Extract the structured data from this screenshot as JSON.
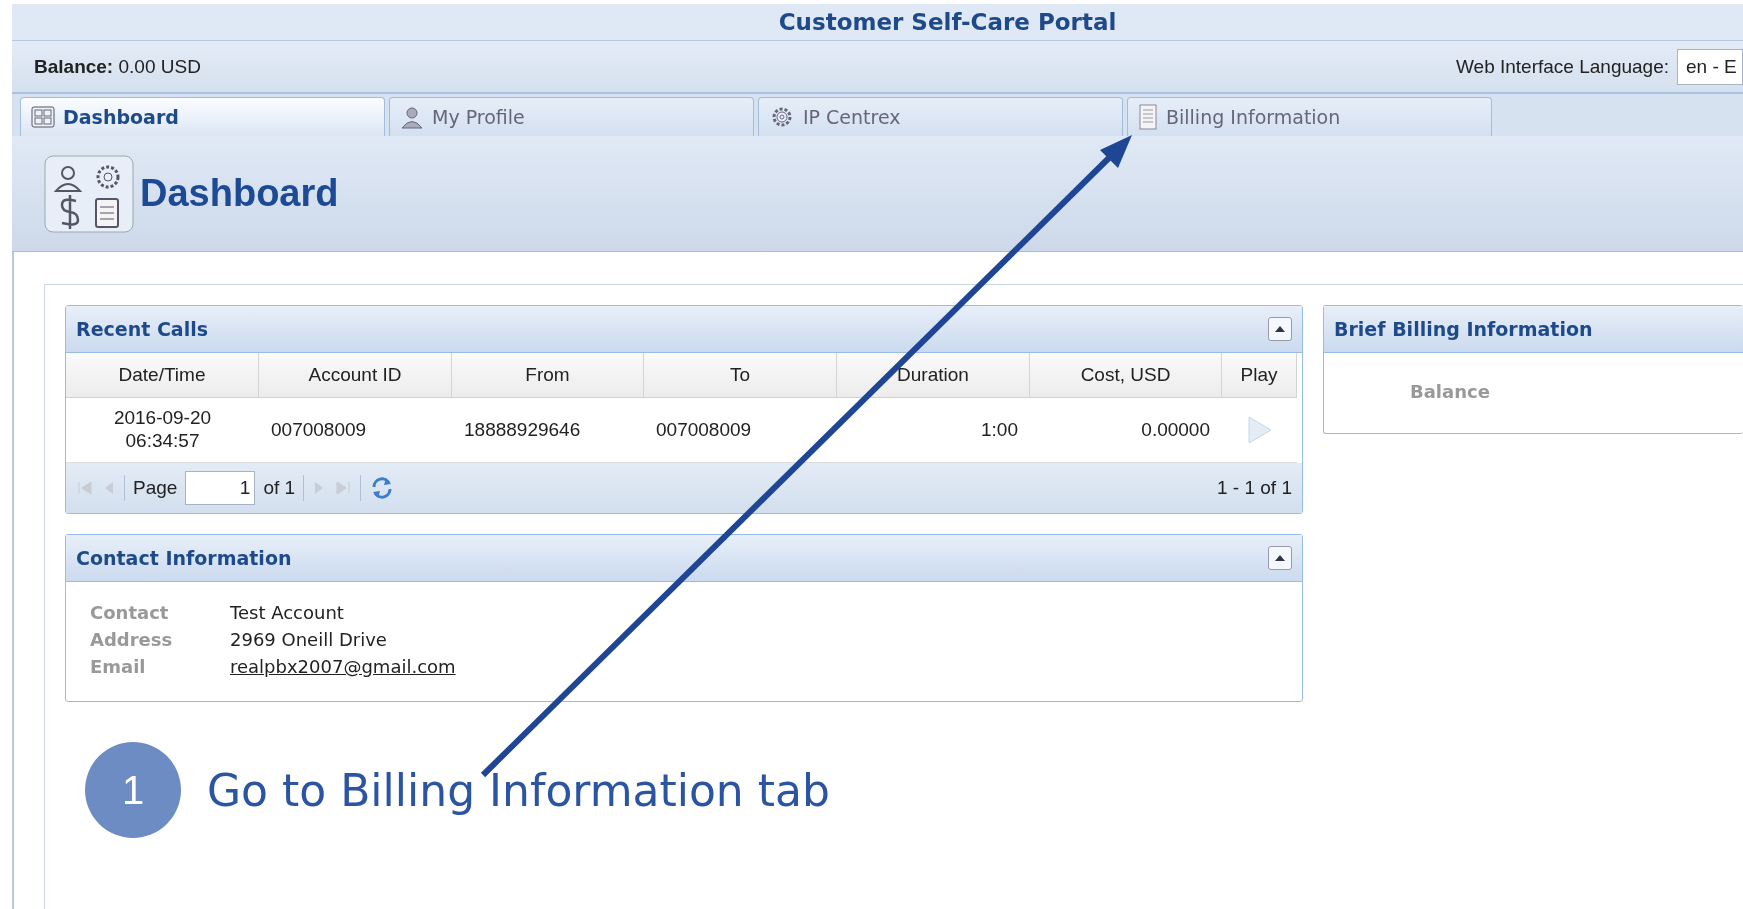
{
  "portal_title": "Customer Self-Care Portal",
  "balance": {
    "label": "Balance:",
    "value": "0.00 USD"
  },
  "language": {
    "label": "Web Interface Language:",
    "value": "en - E"
  },
  "tabs": [
    {
      "label": "Dashboard",
      "kind": "grid",
      "selected": true
    },
    {
      "label": "My Profile",
      "kind": "person",
      "selected": false
    },
    {
      "label": "IP Centrex",
      "kind": "gear",
      "selected": false
    },
    {
      "label": "Billing Information",
      "kind": "doc",
      "selected": false
    }
  ],
  "page_title": "Dashboard",
  "recent_calls": {
    "title": "Recent Calls",
    "expanded": true,
    "columns": [
      "Date/Time",
      "Account ID",
      "From",
      "To",
      "Duration",
      "Cost, USD",
      "Play"
    ],
    "rows": [
      {
        "date": "2016-09-20",
        "time": "06:34:57",
        "account": "007008009",
        "from": "18888929646",
        "to": "007008009",
        "duration": "1:00",
        "cost": "0.00000"
      }
    ],
    "pager": {
      "page_label": "Page",
      "page": "1",
      "of": "of 1",
      "summary": "1 - 1 of 1"
    }
  },
  "contact": {
    "title": "Contact Information",
    "expanded": true,
    "fields": [
      {
        "label": "Contact",
        "value": "Test Account",
        "kind": "text"
      },
      {
        "label": "Address",
        "value": "2969 Oneill Drive",
        "kind": "text"
      },
      {
        "label": "Email",
        "value": "realpbx2007@gmail.com",
        "kind": "link"
      }
    ]
  },
  "brief_billing": {
    "title": "Brief Billing Information",
    "fields": [
      "Balance"
    ]
  },
  "annotation": {
    "step": "1",
    "text": "Go to Billing Information tab"
  }
}
